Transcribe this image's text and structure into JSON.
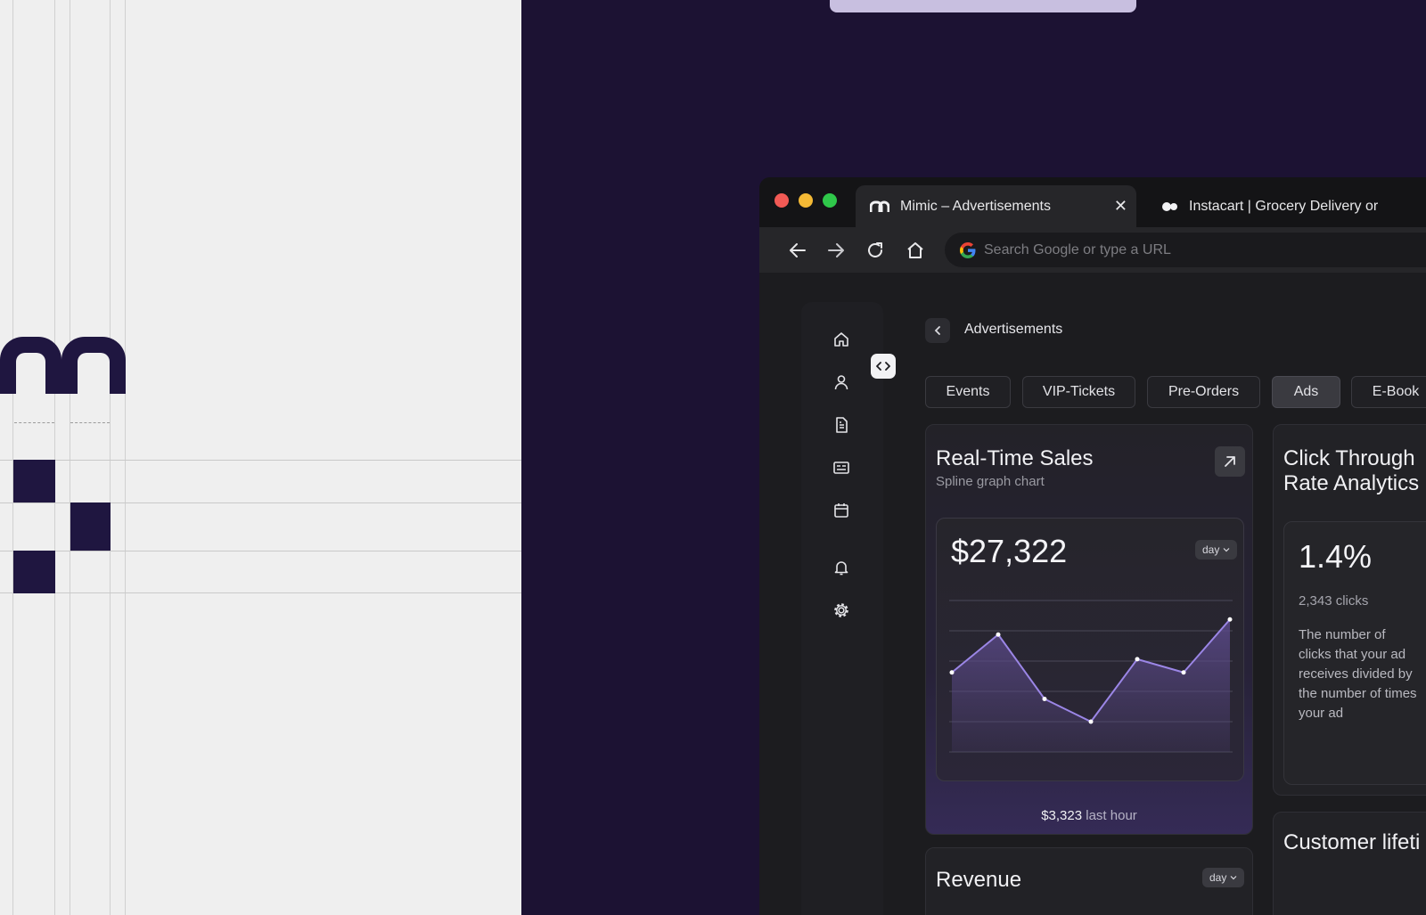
{
  "browser": {
    "tabs": [
      {
        "title": "Mimic – Advertisements",
        "active": true
      },
      {
        "title": "Instacart | Grocery Delivery or",
        "active": false
      }
    ],
    "address_placeholder": "Search Google or type a URL"
  },
  "breadcrumb": {
    "title": "Advertisements"
  },
  "filters": [
    "Events",
    "VIP-Tickets",
    "Pre-Orders",
    "Ads",
    "E-Book"
  ],
  "active_filter": "Ads",
  "sales_card": {
    "title": "Real-Time Sales",
    "subtitle": "Spline graph chart",
    "value": "$27,322",
    "period": "day",
    "footer_amount": "$3,323",
    "footer_label": "last hour"
  },
  "chart_data": {
    "type": "area",
    "x": [
      1,
      2,
      3,
      4,
      5,
      6,
      7
    ],
    "values": [
      42,
      62,
      28,
      16,
      49,
      42,
      70
    ],
    "ylim": [
      0,
      80
    ],
    "grid": true,
    "colors": {
      "line": "#9b86e6",
      "fill": "#5b4a8a"
    }
  },
  "ctr_card": {
    "title": "Click Through Rate Analytics",
    "title_line1": "Click Through",
    "title_line2": "Rate Analytics",
    "value": "1.4%",
    "clicks": "2,343 clicks",
    "description": "The number of\nclicks that your ad\nreceives divided by\nthe number of times\nyour ad"
  },
  "revenue_card": {
    "title": "Revenue",
    "period": "day"
  },
  "customer_card": {
    "title": "Customer lifeti"
  },
  "colors": {
    "brand": "#1f1640",
    "background": "#1c1233",
    "accent": "#9b86e6"
  }
}
